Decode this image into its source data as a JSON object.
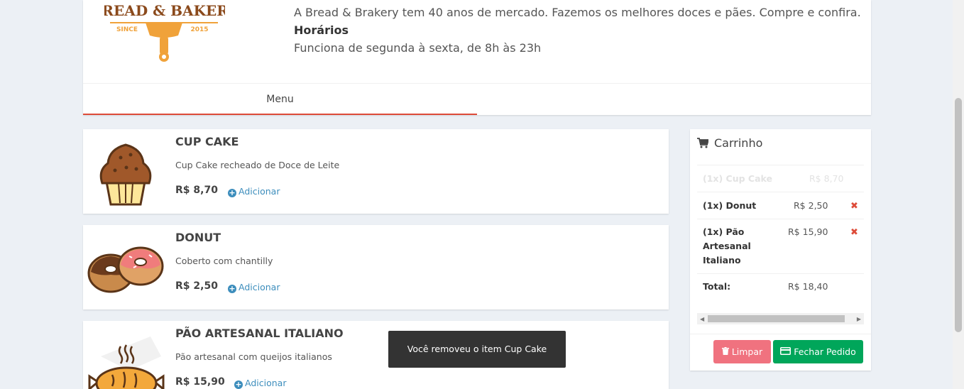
{
  "store": {
    "logo_text": "BREAD & BAKERY",
    "logo_since": "SINCE",
    "logo_year": "2015",
    "description": "A Bread & Brakery tem 40 anos de mercado. Fazemos os melhores doces e pães. Compre e confira.",
    "hours_title": "Horários",
    "hours_text": "Funciona de segunda à sexta, de 8h às 23h"
  },
  "tabs": [
    {
      "label": "Menu"
    }
  ],
  "products": [
    {
      "name": "CUP CAKE",
      "description": "Cup Cake recheado de Doce de Leite",
      "price": "R$ 8,70",
      "add_label": "Adicionar",
      "icon": "cupcake-icon"
    },
    {
      "name": "DONUT",
      "description": "Coberto com chantilly",
      "price": "R$ 2,50",
      "add_label": "Adicionar",
      "icon": "donut-icon"
    },
    {
      "name": "PÃO ARTESANAL ITALIANO",
      "description": "Pão artesanal com queijos italianos",
      "price": "R$ 15,90",
      "add_label": "Adicionar",
      "icon": "bread-icon"
    }
  ],
  "cart": {
    "title": "Carrinho",
    "icon": "shopping-cart-icon",
    "items": [
      {
        "label": "(1x) Cup Cake",
        "price": "R$ 8,70",
        "removed": true
      },
      {
        "label": "(1x) Donut",
        "price": "R$ 2,50",
        "removed": false
      },
      {
        "label": "(1x) Pão Artesanal Italiano",
        "price": "R$ 15,90",
        "removed": false
      }
    ],
    "total_label": "Total:",
    "total_value": "R$ 18,40",
    "clear_label": "Limpar",
    "checkout_label": "Fechar Pedido"
  },
  "toast": {
    "message": "Você removeu o item Cup Cake"
  },
  "colors": {
    "accent_red": "#dd4b39",
    "link_blue": "#3c8dbc",
    "success_green": "#00a65a",
    "danger_pink": "#f0727f",
    "logo_orange": "#f0a23a",
    "logo_brown": "#8b4a1c"
  }
}
